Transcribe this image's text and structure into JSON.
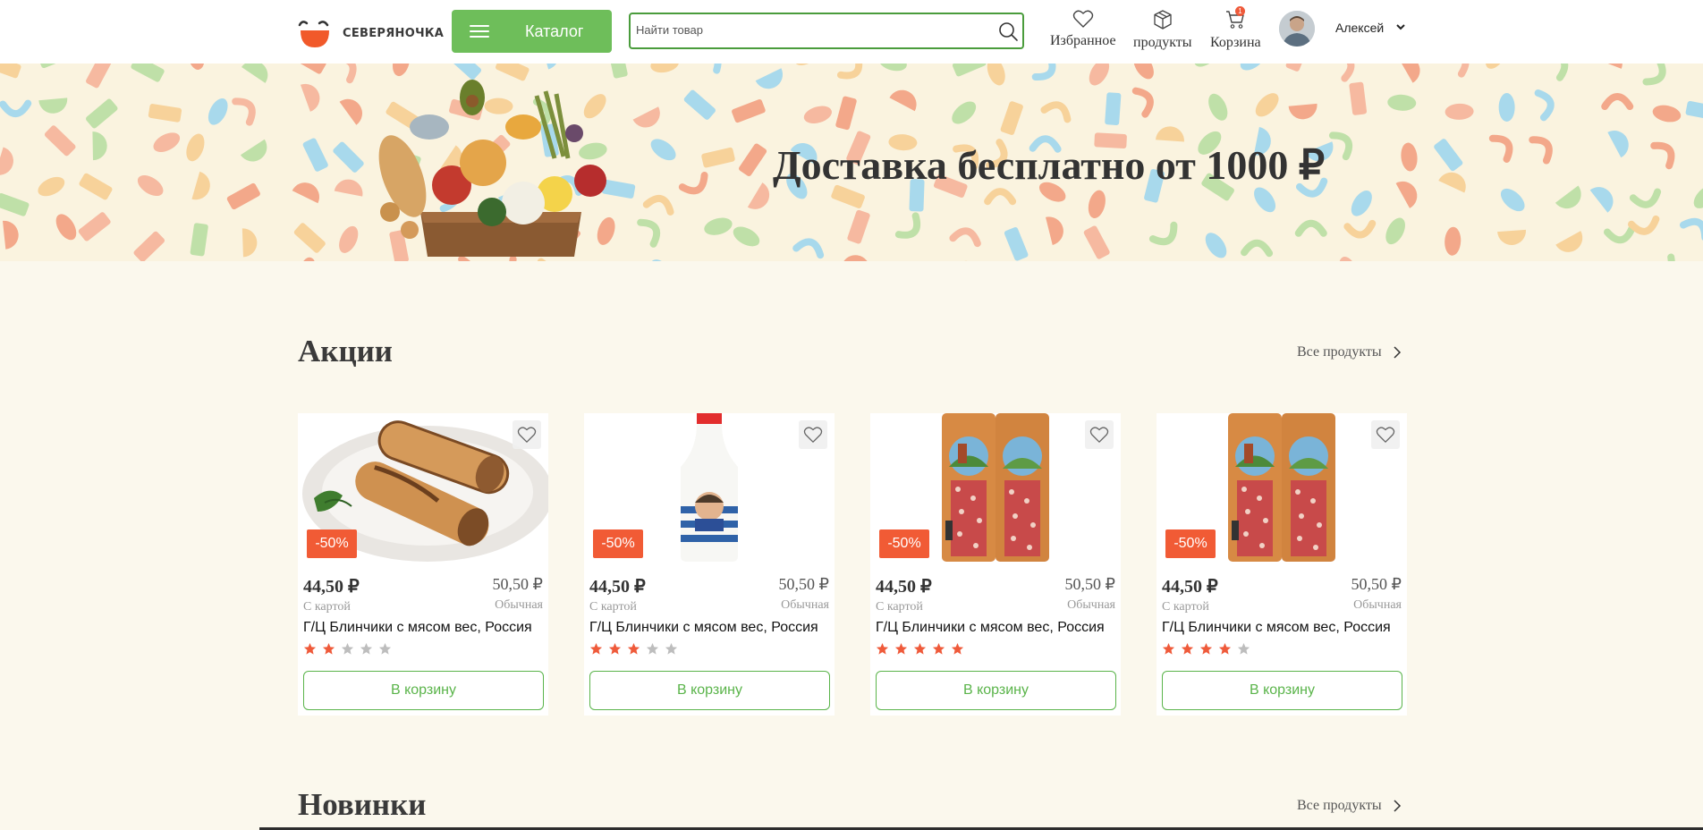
{
  "header": {
    "logo_text": "СЕВЕРЯНОЧКА",
    "catalog_label": "Каталог",
    "search_placeholder": "Найти товар",
    "favorites_label": "Избранное",
    "products_label": "продукты",
    "cart_label": "Корзина",
    "cart_count": "1",
    "user_name": "Алексей"
  },
  "banner": {
    "title": "Доставка бесплатно от 1000 ₽"
  },
  "sections": {
    "promo": {
      "title": "Акции",
      "all_link": "Все продукты"
    },
    "new": {
      "title": "Новинки",
      "all_link": "Все продукты"
    }
  },
  "products": [
    {
      "image": "pancakes",
      "discount": "-50%",
      "price": "44,50 ₽",
      "price_note": "С картой",
      "old_price": "50,50 ₽",
      "old_note": "Обычная",
      "title": "Г/Ц Блинчики с мясом вес, Россия",
      "rating": 2,
      "button": "В корзину"
    },
    {
      "image": "milk",
      "discount": "-50%",
      "price": "44,50 ₽",
      "price_note": "С картой",
      "old_price": "50,50 ₽",
      "old_note": "Обычная",
      "title": "Г/Ц Блинчики с мясом вес, Россия",
      "rating": 3,
      "button": "В корзину"
    },
    {
      "image": "sausage",
      "discount": "-50%",
      "price": "44,50 ₽",
      "price_note": "С картой",
      "old_price": "50,50 ₽",
      "old_note": "Обычная",
      "title": "Г/Ц Блинчики с мясом вес, Россия",
      "rating": 5,
      "button": "В корзину"
    },
    {
      "image": "sausage",
      "discount": "-50%",
      "price": "44,50 ₽",
      "price_note": "С картой",
      "old_price": "50,50 ₽",
      "old_note": "Обычная",
      "title": "Г/Ц Блинчики с мясом вес, Россия",
      "rating": 4,
      "button": "В корзину"
    }
  ],
  "colors": {
    "accent_green": "#6ebe5a",
    "discount_red": "#f15b35",
    "star_active": "#ef5a3a",
    "star_inactive": "#bdbdbd",
    "page_bg": "#fbf8ed"
  }
}
